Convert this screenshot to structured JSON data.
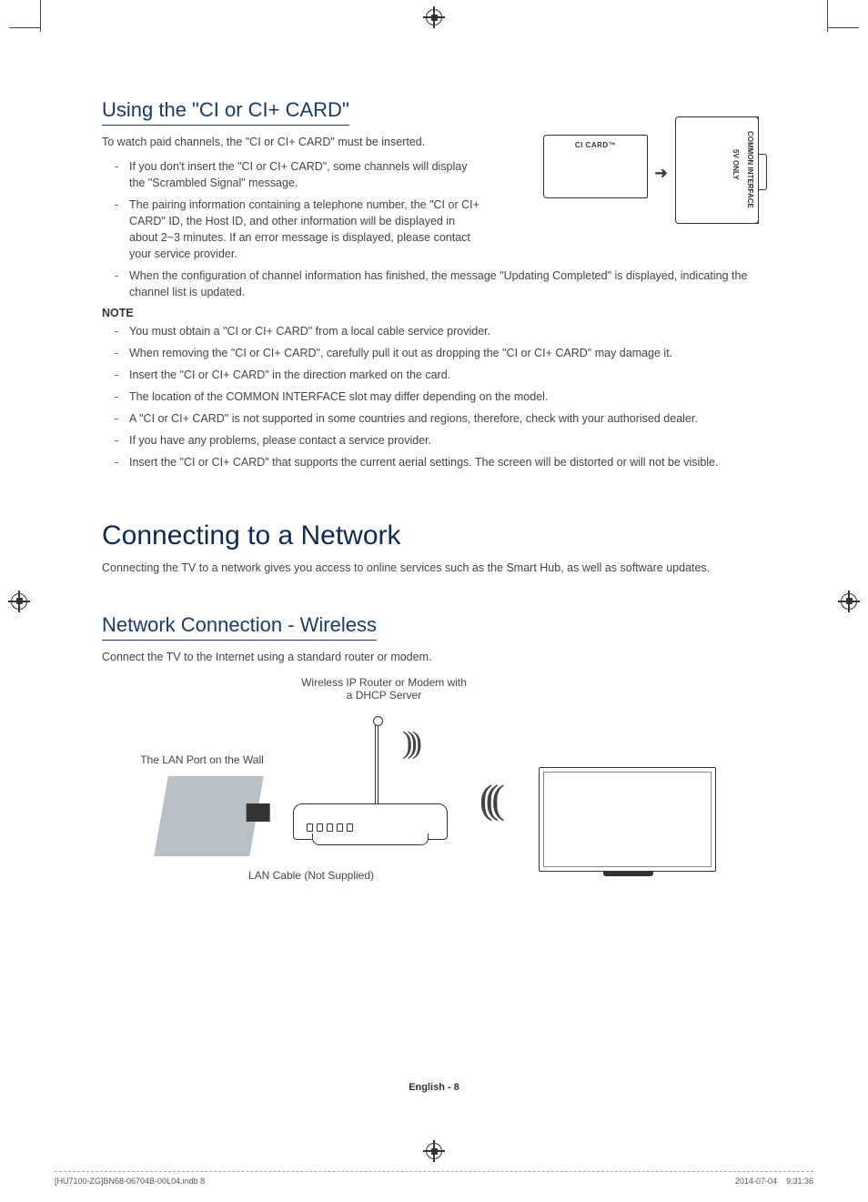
{
  "section1": {
    "title": "Using the \"CI or CI+ CARD\"",
    "intro": "To watch paid channels, the \"CI or CI+ CARD\" must be inserted.",
    "bullets": [
      "If you don't insert the \"CI or CI+ CARD\", some channels will display the \"Scrambled Signal\" message.",
      "The pairing information containing a telephone number, the \"CI or CI+ CARD\" ID, the Host ID, and other information will be displayed in about 2~3 minutes. If an error message is displayed, please contact your service provider.",
      "When the configuration of channel information has finished, the message \"Updating Completed\" is displayed, indicating the channel list is updated."
    ],
    "note_heading": "NOTE",
    "notes": [
      "You must obtain a \"CI or CI+ CARD\" from a local cable service provider.",
      "When removing the \"CI or CI+ CARD\", carefully pull it out as dropping the \"CI or CI+ CARD\" may damage it.",
      "Insert the \"CI or CI+ CARD\" in the direction marked on the card.",
      "The location of the COMMON INTERFACE slot may differ depending on the model.",
      "A \"CI or CI+ CARD\" is not supported in some countries and regions, therefore, check with your authorised dealer.",
      "If you have any problems, please contact a service provider.",
      "Insert the \"CI or CI+ CARD\" that supports the current aerial settings. The screen will be distorted or will not be visible."
    ],
    "diagram": {
      "card_label": "CI CARD™",
      "common_interface": "COMMON INTERFACE",
      "voltage": "5V ONLY"
    }
  },
  "chapter": {
    "title": "Connecting to a Network",
    "intro": "Connecting the TV to a network gives you access to online services such as the Smart Hub, as well as software updates."
  },
  "section2": {
    "title": "Network Connection - Wireless",
    "intro": "Connect the TV to the Internet using a standard router or modem.",
    "diagram": {
      "router_label_1": "Wireless IP Router or Modem with",
      "router_label_2": "a DHCP Server",
      "lan_port": "The LAN Port on the Wall",
      "lan_cable": "LAN Cable (Not Supplied)"
    }
  },
  "footer": {
    "page": "English - 8",
    "file": "[HU7100-ZG]BN68-06704B-00L04.indb   8",
    "timestamp": "2014-07-04      9:31:36"
  }
}
